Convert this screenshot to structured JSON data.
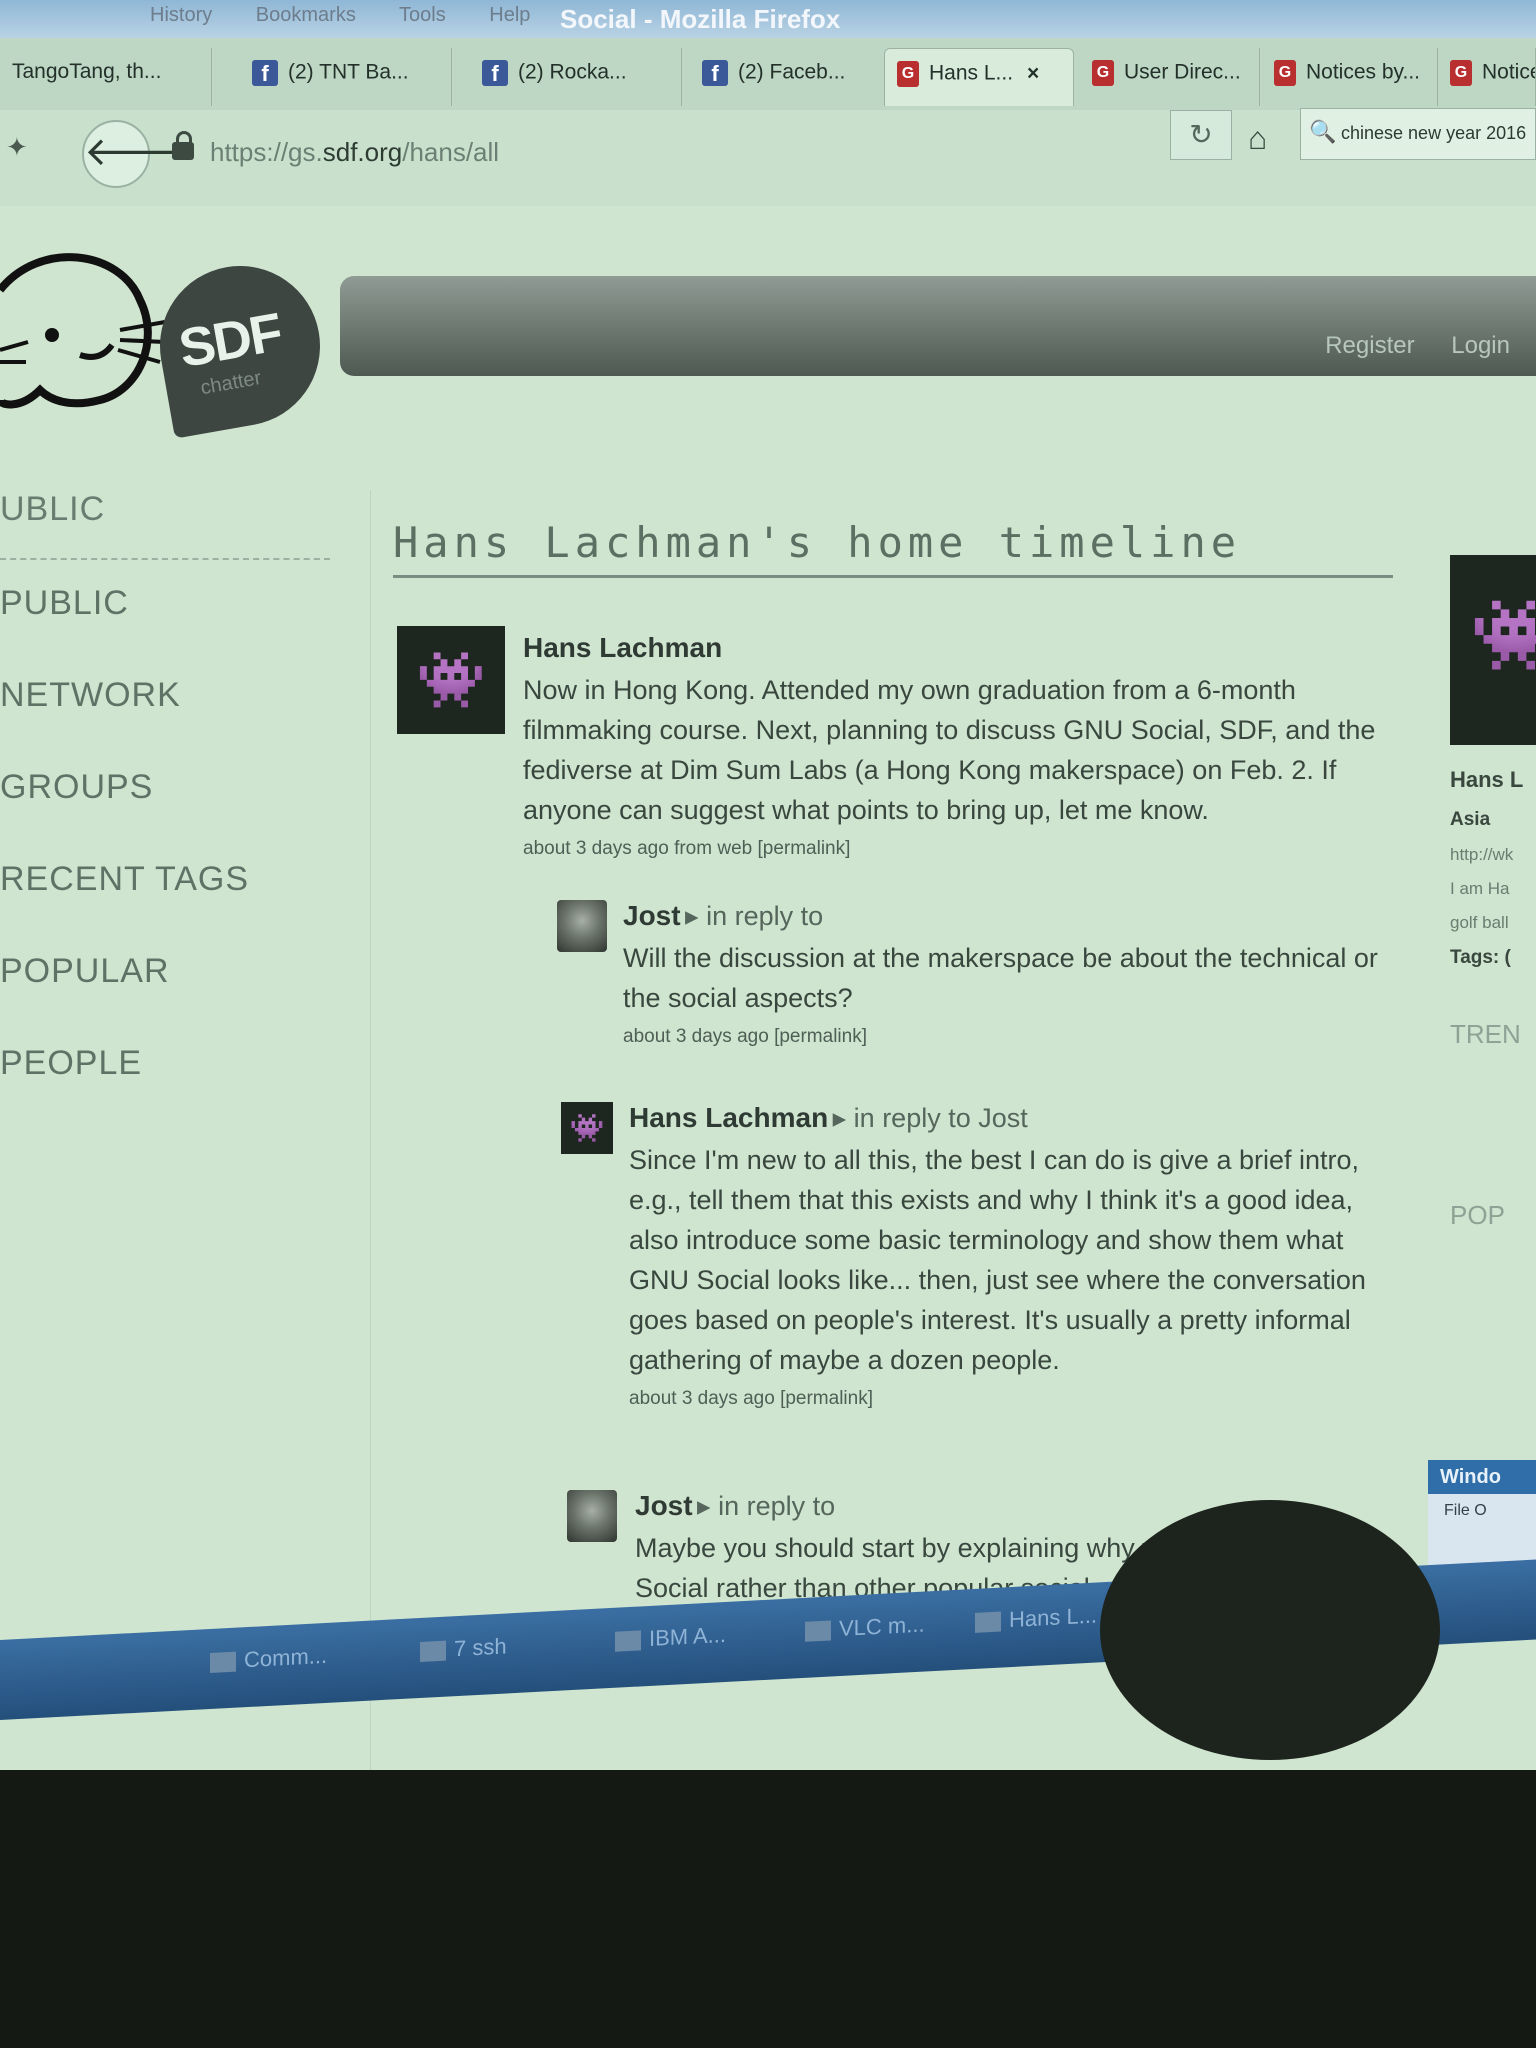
{
  "browser": {
    "window_title": "Social - Mozilla Firefox",
    "menu": [
      "History",
      "Bookmarks",
      "Tools",
      "Help"
    ],
    "tabs": [
      {
        "label": "TangoTang, th...",
        "icon": "none"
      },
      {
        "label": "(2) TNT Ba...",
        "icon": "facebook-icon"
      },
      {
        "label": "(2) Rocka...",
        "icon": "facebook-icon"
      },
      {
        "label": "(2) Faceb...",
        "icon": "facebook-icon"
      },
      {
        "label": "Hans L...",
        "icon": "gnusocial-icon",
        "active": true
      },
      {
        "label": "User Direc...",
        "icon": "gnusocial-icon"
      },
      {
        "label": "Notices by...",
        "icon": "gnusocial-icon"
      },
      {
        "label": "Notices",
        "icon": "gnusocial-icon"
      }
    ],
    "url_prefix": "https://gs.",
    "url_domain": "sdf.org",
    "url_path": "/hans/all",
    "search_value": "chinese new year 2016",
    "tab_close_glyph": "×"
  },
  "site": {
    "logo_text": "SDF",
    "logo_sub": "chatter",
    "register": "Register",
    "login": "Login"
  },
  "sidebar": {
    "items": [
      "UBLIC",
      "PUBLIC",
      "NETWORK",
      "GROUPS",
      "RECENT TAGS",
      "POPULAR",
      "PEOPLE"
    ]
  },
  "timeline": {
    "title": "Hans Lachman's home timeline",
    "notices": [
      {
        "author": "Hans Lachman",
        "reply": "",
        "text": "Now in Hong Kong. Attended my own graduation from a 6-month filmmaking course. Next, planning to discuss GNU Social, SDF, and the fediverse at Dim Sum Labs (a Hong Kong makerspace) on Feb. 2. If anyone can suggest what points to bring up, let me know.",
        "meta": "about 3 days ago from web [permalink]"
      },
      {
        "author": "Jost",
        "reply": "▸ in reply to",
        "text": "Will the discussion at the makerspace be about the technical or the social aspects?",
        "meta": "about 3 days ago [permalink]"
      },
      {
        "author": "Hans Lachman",
        "reply": "▸ in reply to Jost",
        "text": "Since I'm new to all this, the best I can do is give a brief intro, e.g., tell them that this exists and why I think it's a good idea, also introduce some basic terminology and show them what GNU Social looks like... then, just see where the conversation goes based on people's interest. It's usually a pretty informal gathering of maybe a dozen people.",
        "meta": "about 3 days ago [permalink]"
      },
      {
        "author": "Jost",
        "reply": "▸ in reply to",
        "text": "Maybe you should start by explaining why you w... to join GNU Social rather than other popular social...",
        "meta": ""
      }
    ]
  },
  "profile": {
    "name": "Hans L",
    "location": "Asia",
    "url": "http://wk",
    "bio1": "I am Ha",
    "bio2": "golf ball",
    "tags": "Tags: (",
    "section1": "TREN",
    "section2": "POP"
  },
  "taskbar": {
    "items": [
      "Comm...",
      "7 ssh",
      "IBM A...",
      "VLC m...",
      "Hans L..."
    ]
  },
  "popup": {
    "title": "Windo",
    "menu": "File  O"
  },
  "colors": {
    "screen_tint": "#cfe5cf",
    "taskbar": "#2f5f8f",
    "avatar_green": "#7a9a3a"
  }
}
